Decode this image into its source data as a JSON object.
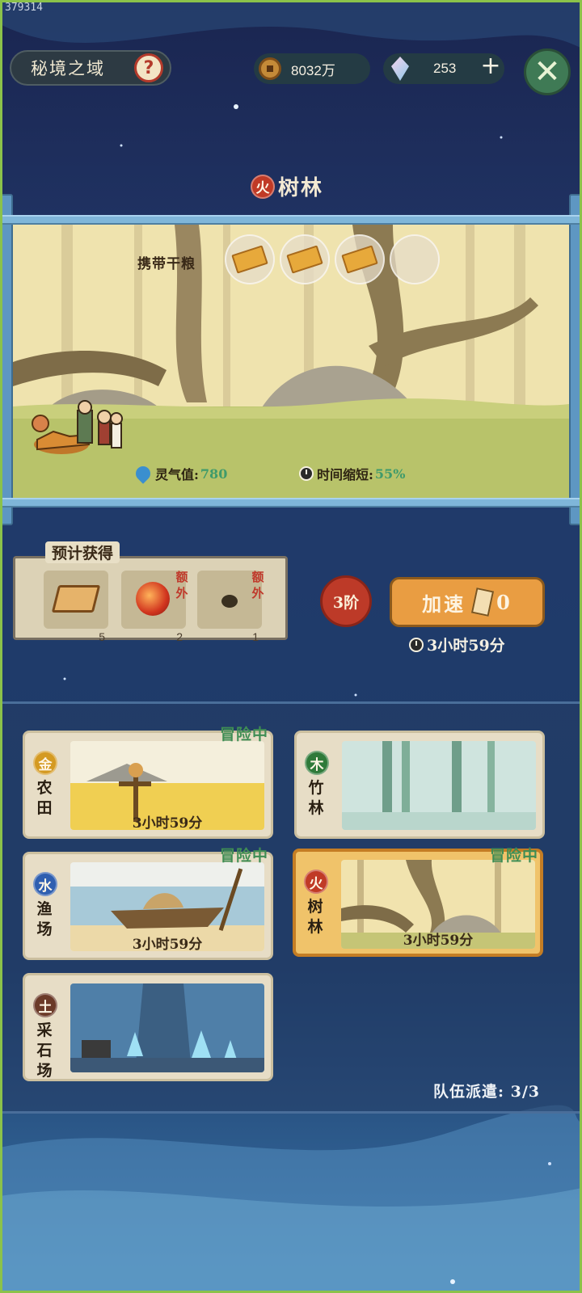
{
  "build_id": "379314",
  "header": {
    "title": "秘境之域",
    "help_icon": "question-icon",
    "coins": "8032万",
    "gems": "253",
    "add_label": "+",
    "close_label": "✕"
  },
  "location": {
    "element": "火",
    "name": "树林"
  },
  "scene": {
    "carry_label": "携带干粮",
    "rations": [
      "ration",
      "ration",
      "ration",
      "empty"
    ],
    "spirit_label": "灵气值:",
    "spirit_value": "780",
    "time_label": "时间缩短:",
    "time_value": "55%"
  },
  "expected": {
    "title": "预计获得",
    "rewards": [
      {
        "icon": "book-icon",
        "count": "5",
        "extra": ""
      },
      {
        "icon": "fire-orb-icon",
        "count": "2",
        "extra": "额外"
      },
      {
        "icon": "seed-icon",
        "count": "1",
        "extra": "额外"
      }
    ]
  },
  "actions": {
    "tier": "3阶",
    "speed_label": "加速",
    "speed_count": "0",
    "remaining_time": "3小时59分"
  },
  "expeditions": [
    {
      "element": "金",
      "name": "农田",
      "status": "冒险中",
      "timer": "3小时59分",
      "selected": false
    },
    {
      "element": "木",
      "name": "竹林",
      "status": "",
      "timer": "",
      "selected": false
    },
    {
      "element": "水",
      "name": "渔场",
      "status": "冒险中",
      "timer": "3小时59分",
      "selected": false
    },
    {
      "element": "火",
      "name": "树林",
      "status": "冒险中",
      "timer": "3小时59分",
      "selected": true
    },
    {
      "element": "土",
      "name": "采石场",
      "status": "",
      "timer": "",
      "selected": false
    }
  ],
  "team_dispatch": "队伍派遣: 3/3",
  "colors": {
    "fire": "#c03a26",
    "metal": "#d49a22",
    "wood": "#2f7a3a",
    "water": "#2f5fb0",
    "earth": "#6b3a28",
    "adventuring": "#3f8d54",
    "selected_card": "#f0c36a"
  }
}
